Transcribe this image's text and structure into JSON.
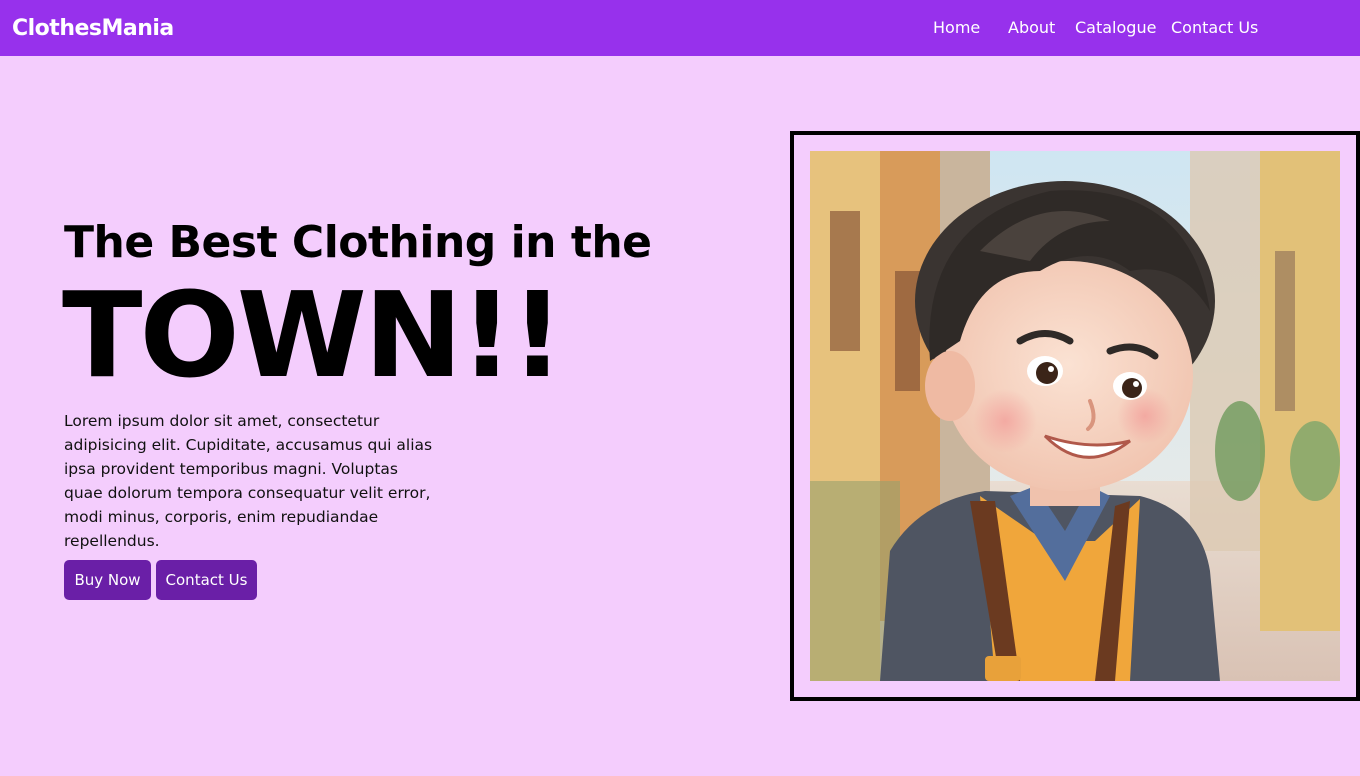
{
  "navbar": {
    "brand": "ClothesMania",
    "links": [
      {
        "label": "Home"
      },
      {
        "label": "About"
      },
      {
        "label": "Catalogue"
      },
      {
        "label": "Contact Us"
      }
    ]
  },
  "hero": {
    "subtitle": "The Best Clothing in the",
    "title": "TOWN!!",
    "description": "Lorem ipsum dolor sit amet, consectetur adipisicing elit. Cupiditate, accusamus qui alias ipsa provident temporibus magni. Voluptas quae dolorum tempora consequatur velit error, modi minus, corporis, enim repudiandae repellendus.",
    "buttons": {
      "buy": "Buy Now",
      "contact": "Contact Us"
    },
    "image": {
      "icon": "cartoon-boy-portrait"
    }
  },
  "colors": {
    "navbar": "#9731ec",
    "background": "#f4cdfd",
    "button": "#6a1fa7",
    "frame_border": "#000000"
  }
}
